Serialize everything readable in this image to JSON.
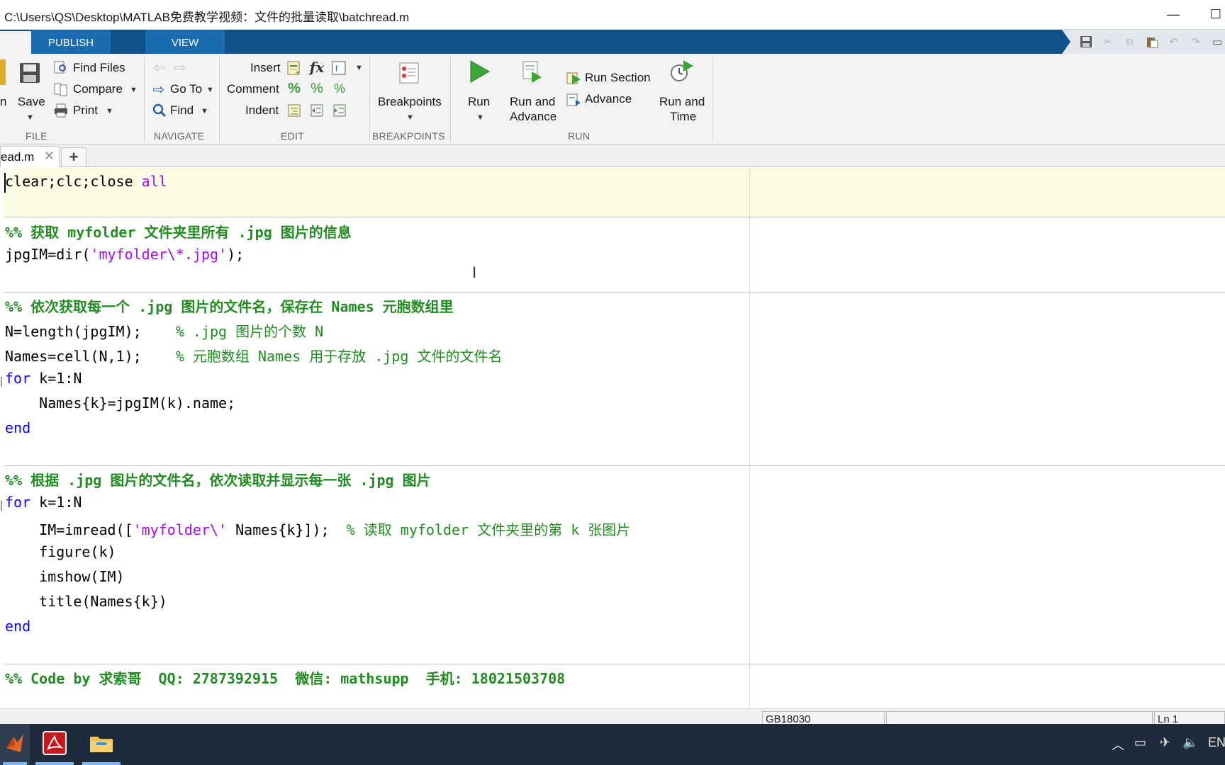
{
  "window": {
    "title": "C:\\Users\\QS\\Desktop\\MATLAB免费教学视频：文件的批量读取\\batchread.m",
    "minimize": "—",
    "maximize": "☐"
  },
  "toolstrip": {
    "tabs": [
      "PUBLISH",
      "VIEW"
    ]
  },
  "ribbon": {
    "file": {
      "partial_label": "n",
      "save": "Save",
      "find_files": "Find Files",
      "compare": "Compare",
      "print": "Print",
      "group": "FILE"
    },
    "navigate": {
      "go_to": "Go To",
      "find": "Find",
      "group": "NAVIGATE"
    },
    "edit": {
      "insert": "Insert",
      "comment": "Comment",
      "indent": "Indent",
      "group": "EDIT"
    },
    "breakpoints": {
      "button": "Breakpoints",
      "group": "BREAKPOINTS"
    },
    "run": {
      "run": "Run",
      "run_and_advance_1": "Run and",
      "run_and_advance_2": "Advance",
      "run_section": "Run Section",
      "advance": "Advance",
      "run_and_time_1": "Run and",
      "run_and_time_2": "Time",
      "group": "RUN"
    }
  },
  "editor_tabs": {
    "file_tab": "ead.m",
    "close_glyph": "✕",
    "add_glyph": "+"
  },
  "code": {
    "l1": {
      "a": "clear;clc;close ",
      "b": "all"
    },
    "s2": "%% 获取 myfolder 文件夹里所有 .jpg 图片的信息",
    "l3": {
      "a": "jpgIM=dir(",
      "b": "'myfolder\\*.jpg'",
      "c": ");"
    },
    "s4": "%% 依次获取每一个 .jpg 图片的文件名，保存在 Names 元胞数组里",
    "l5": {
      "a": "N=length(jpgIM);    ",
      "b": "% .jpg 图片的个数 N"
    },
    "l6": {
      "a": "Names=cell(N,1);    ",
      "b": "% 元胞数组 Names 用于存放 .jpg 文件的文件名"
    },
    "l7": {
      "a": "for",
      "b": " k=1:N"
    },
    "l8": "    Names{k}=jpgIM(k).name;",
    "l9": "end",
    "s10": "%% 根据 .jpg 图片的文件名，依次读取并显示每一张 .jpg 图片",
    "l11": {
      "a": "for",
      "b": " k=1:N"
    },
    "l12": {
      "a": "    IM=imread([",
      "b": "'myfolder\\'",
      "c": " Names{k}]);  ",
      "d": "% 读取 myfolder 文件夹里的第 k 张图片"
    },
    "l13": "    figure(k)",
    "l14": "    imshow(IM)",
    "l15": "    title(Names{k})",
    "l16": "end",
    "s17": "%% Code by 求索哥  QQ: 2787392915  微信: mathsupp  手机: 18021503708"
  },
  "status": {
    "encoding": "GB18030",
    "position": "Ln  1"
  },
  "taskbar": {
    "language": "EN"
  },
  "colors": {
    "keyword": "#0e00ff",
    "string": "#a709f5",
    "comment": "#228b22",
    "toolstrip_blue": "#1b6bb0",
    "taskbar": "#1f2b3a"
  }
}
